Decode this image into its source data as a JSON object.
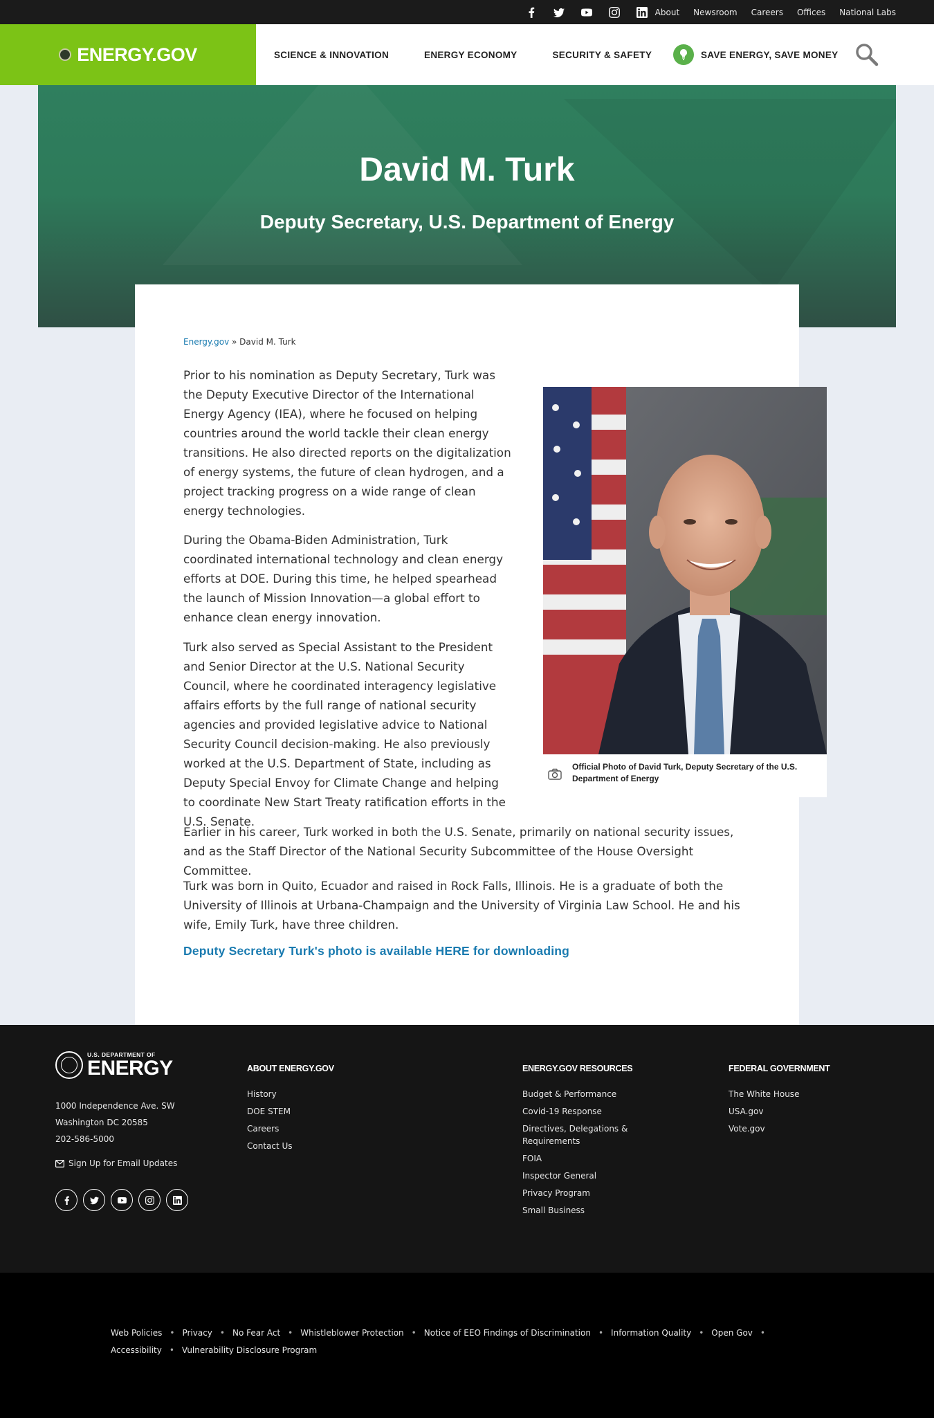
{
  "utility": {
    "social_icons": [
      "facebook-icon",
      "twitter-icon",
      "youtube-icon",
      "instagram-icon",
      "linkedin-icon"
    ],
    "links": [
      "About",
      "Newsroom",
      "Careers",
      "Offices",
      "National Labs"
    ]
  },
  "nav": {
    "logo": "ENERGY.GOV",
    "items": [
      "SCIENCE & INNOVATION",
      "ENERGY ECONOMY",
      "SECURITY & SAFETY"
    ],
    "save_energy": "SAVE ENERGY, SAVE MONEY"
  },
  "hero": {
    "title": "David M. Turk",
    "subtitle": "Deputy Secretary, U.S. Department of Energy"
  },
  "breadcrumb": {
    "home": "Energy.gov",
    "separator": " » ",
    "current": "David M. Turk"
  },
  "article": {
    "paragraphs": [
      "Prior to his nomination as Deputy Secretary, Turk was the Deputy Executive Director of the International Energy Agency (IEA), where he focused on helping countries around the world tackle their clean energy transitions. He also directed reports on the digitalization of energy systems, the future of clean hydrogen, and a project tracking progress on a wide range of clean energy technologies.",
      "During the Obama-Biden Administration, Turk coordinated international technology and clean energy efforts at DOE. During this time, he helped spearhead the launch of Mission Innovation—a global effort to enhance clean energy innovation.",
      "Turk also served as Special Assistant to the President and Senior Director at the U.S. National Security Council, where he coordinated interagency legislative affairs efforts by the full range of national security agencies and provided legislative advice to National Security Council decision-making. He also previously worked at the U.S. Department of State, including as Deputy Special Envoy for Climate Change and helping to coordinate New Start Treaty ratification efforts in the U.S. Senate.",
      "Earlier in his career, Turk worked in both the U.S. Senate, primarily on national security issues, and as the Staff Director of the National Security Subcommittee of the House Oversight Committee.",
      "Turk was born in Quito, Ecuador and raised in Rock Falls, Illinois. He is a graduate of both the University of Illinois at Urbana-Champaign and the University of Virginia Law School. He and his wife, Emily Turk, have three children."
    ],
    "download_link": "Deputy Secretary Turk's photo is available HERE for downloading",
    "photo_caption": "Official Photo of David Turk, Deputy Secretary of the U.S. Department of Energy"
  },
  "footer": {
    "logo_small": "U.S. DEPARTMENT OF",
    "logo_big": "ENERGY",
    "address": [
      "1000 Independence Ave. SW",
      "Washington DC 20585",
      "202-586-5000"
    ],
    "signup": "Sign Up for Email Updates",
    "columns": [
      {
        "title": "ABOUT ENERGY.GOV",
        "links": [
          "History",
          "DOE STEM",
          "Careers",
          "Contact Us"
        ]
      },
      {
        "title": "ENERGY.GOV RESOURCES",
        "links": [
          "Budget & Performance",
          "Covid-19 Response",
          "Directives, Delegations & Requirements",
          "FOIA",
          "Inspector General",
          "Privacy Program",
          "Small Business"
        ]
      },
      {
        "title": "FEDERAL GOVERNMENT",
        "links": [
          "The White House",
          "USA.gov",
          "Vote.gov"
        ]
      }
    ]
  },
  "legal": {
    "links": [
      "Web Policies",
      "Privacy",
      "No Fear Act",
      "Whistleblower Protection",
      "Notice of EEO Findings of Discrimination",
      "Information Quality",
      "Open Gov",
      "Accessibility",
      "Vulnerability Disclosure Program"
    ]
  },
  "colors": {
    "brand_green": "#7cc316",
    "hero_green": "#2e7a5a",
    "link_blue": "#1a7bb0",
    "footer_bg": "#151515"
  }
}
